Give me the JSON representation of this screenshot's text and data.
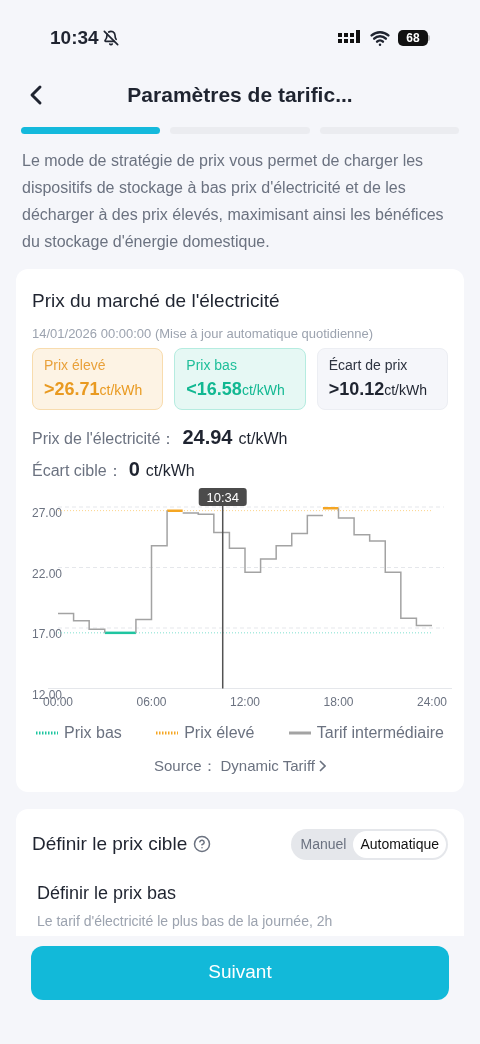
{
  "status_bar": {
    "time": "10:34",
    "battery": "68"
  },
  "header": {
    "title": "Paramètres de tarific..."
  },
  "progress_steps": [
    {
      "active": true
    },
    {
      "active": false
    },
    {
      "active": false
    }
  ],
  "description": "Le mode de stratégie de prix vous permet de charger les dispositifs de stockage à bas prix d'électricité et de les décharger à des prix élevés, maximisant ainsi les bénéfices du stockage d'énergie domestique.",
  "market_card": {
    "title": "Prix du marché de l'électricité",
    "updated": "14/01/2026 00:00:00 (Mise à jour automatique quotidienne)",
    "price_boxes": [
      {
        "kind": "high",
        "label": "Prix élevé",
        "value": ">26.71",
        "unit": "ct/kWh"
      },
      {
        "kind": "low",
        "label": "Prix bas",
        "value": "<16.58",
        "unit": "ct/kWh"
      },
      {
        "kind": "gap",
        "label": "Écart de prix",
        "value": ">10.12",
        "unit": "ct/kWh"
      }
    ],
    "readings": [
      {
        "label": "Prix de l'électricité：",
        "value": "24.94",
        "unit": "ct/kWh"
      },
      {
        "label": "Écart cible：",
        "value": "0",
        "unit": "ct/kWh"
      }
    ],
    "chart_data": {
      "type": "line",
      "x": [
        0,
        1,
        1,
        2,
        2,
        3,
        3,
        4,
        4,
        5,
        5,
        6,
        6,
        7,
        7,
        8,
        8,
        9,
        9,
        10,
        10,
        11,
        11,
        12,
        12,
        13,
        13,
        14,
        14,
        15,
        15,
        16,
        16,
        17,
        17,
        18,
        18,
        19,
        19,
        20,
        20,
        21,
        21,
        22,
        22,
        23,
        23,
        24
      ],
      "xlim": [
        0,
        24
      ],
      "ylim": [
        12,
        27
      ],
      "xticks": [
        {
          "value": 0,
          "label": "00:00"
        },
        {
          "value": 6,
          "label": "06:00"
        },
        {
          "value": 12,
          "label": "12:00"
        },
        {
          "value": 18,
          "label": "18:00"
        },
        {
          "value": 24,
          "label": "24:00"
        }
      ],
      "yticks": [
        {
          "value": 12,
          "label": "12.00"
        },
        {
          "value": 17,
          "label": "17.00"
        },
        {
          "value": 22,
          "label": "22.00"
        },
        {
          "value": 27,
          "label": "27.00"
        }
      ],
      "series": [
        {
          "name": "Prix bas",
          "color": "#1fc5a0",
          "values": [
            null,
            null,
            null,
            null,
            null,
            null,
            16.6,
            16.6,
            16.6,
            16.6,
            null,
            null,
            null,
            null,
            null,
            null,
            null,
            null,
            null,
            null,
            null,
            null,
            null,
            null,
            null,
            null,
            null,
            null,
            null,
            null,
            null,
            null,
            null,
            null,
            null,
            null,
            null,
            null,
            null,
            null,
            null,
            null,
            null,
            null,
            null,
            null,
            null,
            null
          ]
        },
        {
          "name": "Prix élevé",
          "color": "#f5a623",
          "values": [
            null,
            null,
            null,
            null,
            null,
            null,
            null,
            null,
            null,
            null,
            null,
            null,
            null,
            null,
            26.7,
            26.7,
            null,
            null,
            null,
            null,
            null,
            null,
            null,
            null,
            null,
            null,
            null,
            null,
            null,
            null,
            null,
            null,
            null,
            null,
            26.9,
            26.9,
            null,
            null,
            null,
            null,
            null,
            null,
            null,
            null,
            null,
            null,
            null,
            null
          ]
        },
        {
          "name": "Tarif intermédiaire",
          "color": "#a3a3a3",
          "values": [
            18.2,
            18.2,
            17.6,
            17.6,
            16.9,
            16.9,
            16.6,
            null,
            null,
            16.6,
            17.7,
            17.7,
            23.8,
            23.8,
            26.7,
            null,
            26.5,
            26.5,
            26.4,
            26.4,
            24.9,
            24.9,
            23.6,
            23.6,
            21.6,
            21.6,
            22.7,
            22.7,
            23.8,
            23.8,
            24.8,
            24.8,
            26.3,
            26.3,
            null,
            26.9,
            26.1,
            26.1,
            24.7,
            24.7,
            24.2,
            24.2,
            21.6,
            21.6,
            17.8,
            17.8,
            17.2,
            17.2
          ]
        }
      ],
      "ref_lines": [
        {
          "axis": "y",
          "value": 16.6,
          "color": "#7fe0cf"
        },
        {
          "axis": "y",
          "value": 26.7,
          "color": "#fcd38a"
        },
        {
          "axis": "x",
          "value": 10.57,
          "color": "#525252"
        }
      ],
      "annotations": [
        "10:34"
      ]
    },
    "source": {
      "label": "Source：",
      "value": "Dynamic Tariff"
    }
  },
  "target_card": {
    "title": "Définir le prix cible",
    "modes": [
      {
        "label": "Manuel",
        "selected": false
      },
      {
        "label": "Automatique",
        "selected": true
      }
    ],
    "subtitle": "Définir le prix bas",
    "subtitle_text": "Le tarif d'électricité le plus bas de la journée, 2h"
  },
  "next_button": "Suivant"
}
